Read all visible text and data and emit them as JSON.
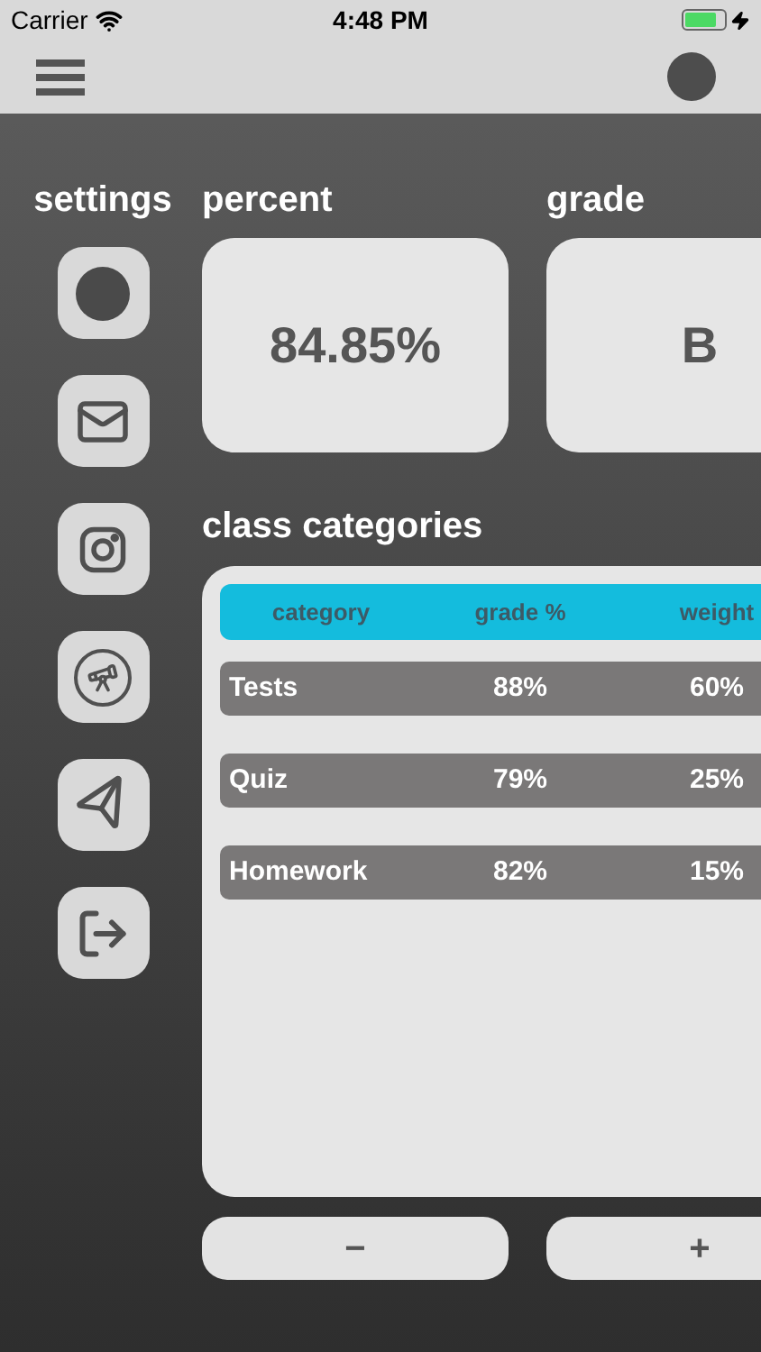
{
  "status_bar": {
    "carrier": "Carrier",
    "time": "4:48 PM"
  },
  "sidebar": {
    "title": "settings",
    "items": [
      {
        "kind": "circle"
      },
      {
        "kind": "mail"
      },
      {
        "kind": "camera"
      },
      {
        "kind": "telescope"
      },
      {
        "kind": "send"
      },
      {
        "kind": "exit"
      }
    ]
  },
  "summary": [
    {
      "title": "percent",
      "value": "84.85%"
    },
    {
      "title": "grade",
      "value": "B"
    }
  ],
  "categories": {
    "title": "class categories",
    "columns": [
      "category",
      "grade %",
      "weight"
    ],
    "rows": [
      {
        "cells": [
          "Tests",
          "88%",
          "60%"
        ]
      },
      {
        "cells": [
          "Quiz",
          "79%",
          "25%"
        ]
      },
      {
        "cells": [
          "Homework",
          "82%",
          "15%"
        ]
      }
    ]
  },
  "buttons": [
    "−",
    "+"
  ]
}
